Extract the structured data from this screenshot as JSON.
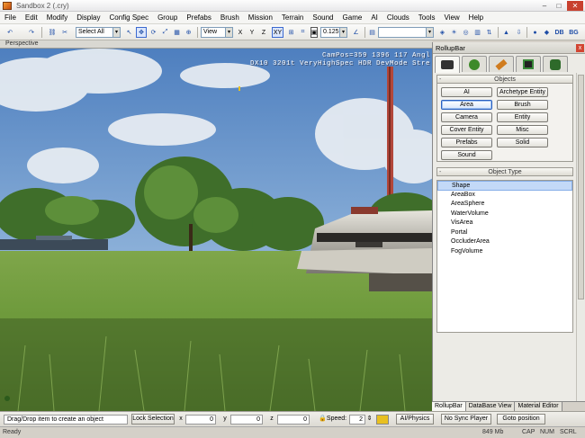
{
  "window": {
    "title": "Sandbox 2 (.cry)",
    "btn_min": "–",
    "btn_max": "□",
    "btn_close": "✕"
  },
  "menu": [
    "File",
    "Edit",
    "Modify",
    "Display",
    "Config Spec",
    "Group",
    "Prefabs",
    "Brush",
    "Mission",
    "Terrain",
    "Sound",
    "Game",
    "AI",
    "Clouds",
    "Tools",
    "View",
    "Help"
  ],
  "toolbar": {
    "select_filter": "Select All",
    "dropdown_arrow": "▾",
    "ref_coords": "View",
    "axis_x": "X",
    "axis_y": "Y",
    "axis_z": "Z",
    "axis_xy": "XY",
    "snap_value": "0.125",
    "layer_value": "",
    "label_db": "DB",
    "label_bg": "BG"
  },
  "viewport": {
    "label": "Perspective",
    "stats_line1": "CamPos=359 1396 117 Angl",
    "stats_line2": "DX10 3201t VeryHighSpec HDR DevMode Stre"
  },
  "rollupbar": {
    "title": "RollupBar",
    "close": "x",
    "tab_icons": [
      "objects-icon",
      "terrain-icon",
      "modelling-icon",
      "display-icon",
      "layers-icon"
    ],
    "objects_header": "Objects",
    "collapse_mark": "-",
    "object_buttons": [
      "AI",
      "Archetype Entity",
      "Area",
      "Brush",
      "Camera",
      "Entity",
      "Cover Entity",
      "Misc",
      "Prefabs",
      "Solid",
      "Sound"
    ],
    "selected_button": "Area",
    "type_header": "Object Type",
    "object_types": [
      "Shape",
      "AreaBox",
      "AreaSphere",
      "WaterVolume",
      "VisArea",
      "Portal",
      "OccluderArea",
      "FogVolume"
    ],
    "selected_type": "Shape"
  },
  "bottom_tabs": [
    "RollupBar",
    "DataBase View",
    "Material Editor"
  ],
  "bottombar": {
    "message": "Drag/Drop item to create an object",
    "lock_selection": "Lock Selection",
    "x_label": "x",
    "x_value": "0",
    "y_label": "y",
    "y_value": "0",
    "z_label": "z",
    "z_value": "0",
    "speed_label": "Speed:",
    "speed_value": "2",
    "ai_physics": "AI/Physics",
    "no_sync_player": "No Sync Player",
    "goto_position": "Goto position"
  },
  "statusbar": {
    "ready": "Ready",
    "memory": "849 Mb",
    "cap": "CAP",
    "num": "NUM",
    "scrl": "SCRL"
  },
  "colors": {
    "accent": "#2a5fbf",
    "selection": "#c3d9f7"
  }
}
